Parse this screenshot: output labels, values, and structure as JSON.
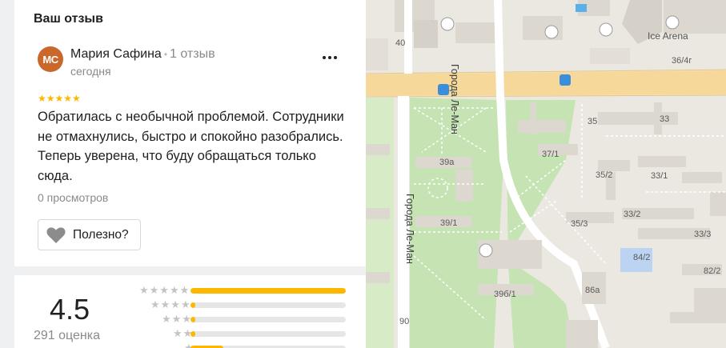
{
  "card": {
    "title": "Ваш отзыв",
    "avatar_initials": "МС",
    "author_name": "Мария Сафина",
    "author_dot": "•",
    "author_reviews": "1 отзыв",
    "date": "сегодня",
    "stars": "★★★★★",
    "text": "Обратилась с необычной проблемой. Сотрудники не отмахнулись, быстро и спокойно разобрались. Теперь уверена, что буду обращаться только сюда.",
    "views": "0 просмотров",
    "useful_label": "Полезно?"
  },
  "rating": {
    "value": "4.5",
    "count": "291 оценка",
    "bars": [
      {
        "stars": "★★★★★",
        "fraction": 1.0
      },
      {
        "stars": "★★★★",
        "fraction": 0.03
      },
      {
        "stars": "★★★",
        "fraction": 0.03
      },
      {
        "stars": "★★",
        "fraction": 0.03
      },
      {
        "stars": "★",
        "fraction": 0.21
      }
    ]
  },
  "map": {
    "streets": {
      "left": "Города Ле-Ман",
      "right": "Города Ле-Ман"
    },
    "poi": "Ice Arena",
    "labels": [
      "40",
      "36/4г",
      "35",
      "33",
      "39а",
      "37/1",
      "35/2",
      "33/1",
      "39/1",
      "35/3",
      "33/2",
      "33/3",
      "84/2",
      "82/2",
      "39б/1",
      "86а",
      "90"
    ]
  },
  "colors": {
    "accent": "#fcb700",
    "avatar": "#c9682a",
    "park": "#c5e3b3",
    "road": "#f6d79b"
  }
}
